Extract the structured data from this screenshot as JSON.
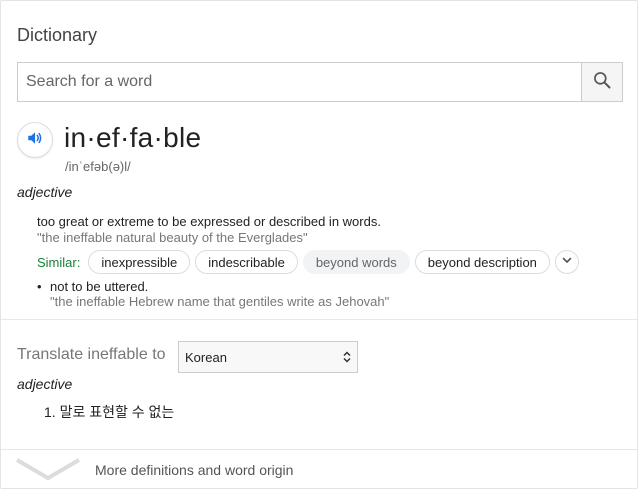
{
  "widget": {
    "title": "Dictionary",
    "search": {
      "placeholder": "Search for a word",
      "value": ""
    }
  },
  "entry": {
    "headword": "in·ef·fa·ble",
    "phonetic": "/inˈefəb(ə)l/",
    "part_of_speech": "adjective",
    "senses": [
      {
        "definition": "too great or extreme to be expressed or described in words.",
        "example": "\"the ineffable natural beauty of the Everglades\"",
        "similar_label": "Similar:",
        "similar": [
          "inexpressible",
          "indescribable",
          "beyond words",
          "beyond description"
        ]
      },
      {
        "bullet": "•",
        "definition": "not to be uttered.",
        "example": "\"the ineffable Hebrew name that gentiles write as Jehovah\""
      }
    ]
  },
  "translate": {
    "label": "Translate ineffable to",
    "language": "Korean",
    "part_of_speech": "adjective",
    "results": [
      "1. 말로 표현할 수 없는"
    ]
  },
  "footer": {
    "more_label": "More definitions and word origin"
  },
  "colors": {
    "accent": "#1a73e8",
    "similar": "#188038"
  },
  "icons": [
    "search-icon",
    "speaker-icon",
    "chevron-down-icon",
    "select-caret-icon",
    "expand-chevron-icon"
  ]
}
